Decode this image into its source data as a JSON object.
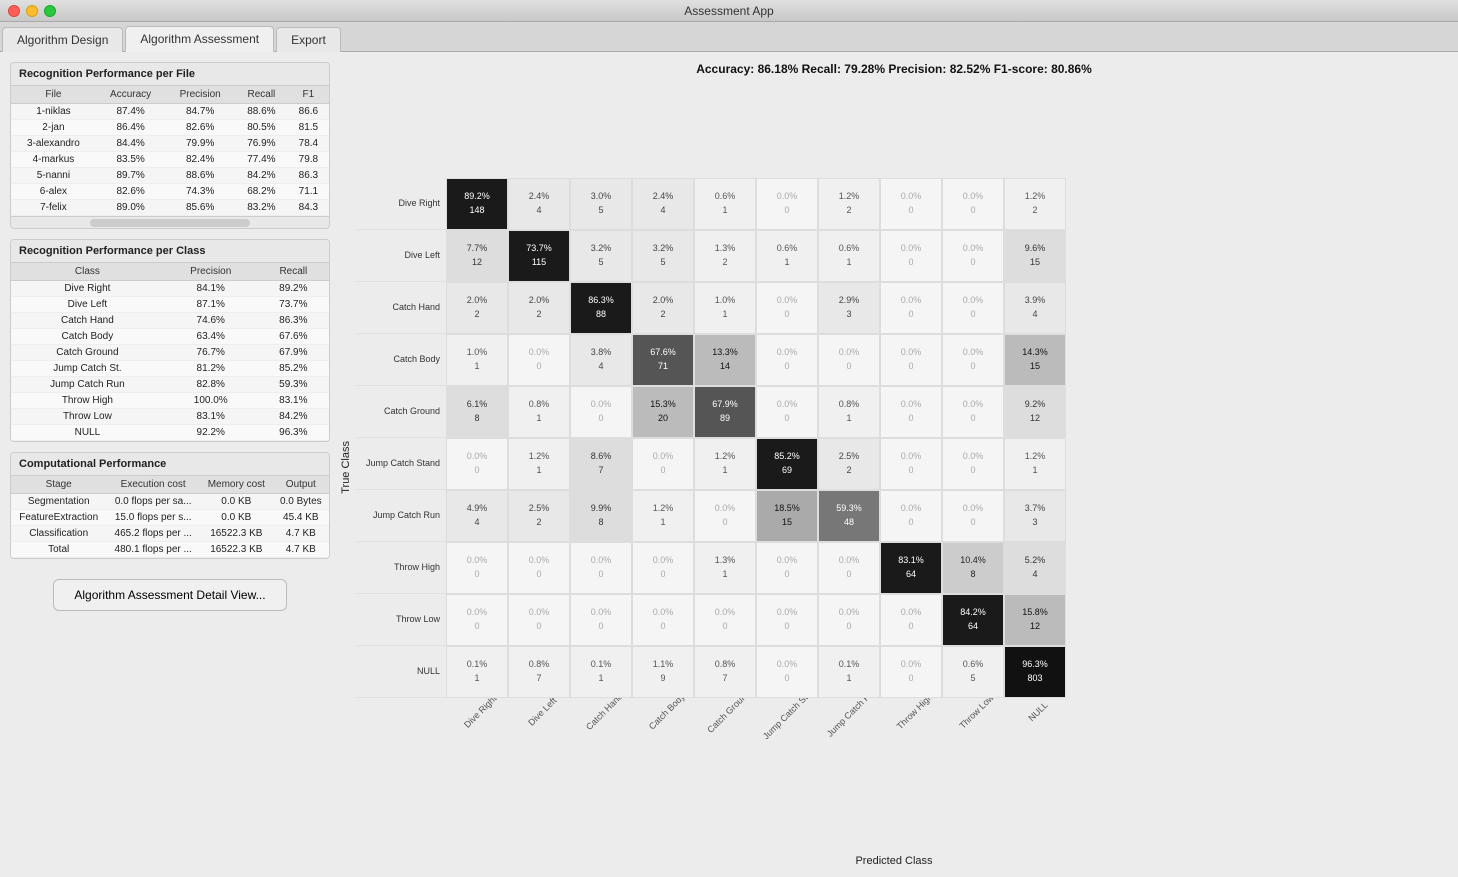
{
  "app": {
    "title": "Assessment App",
    "tabs": [
      {
        "id": "algorithm-design",
        "label": "Algorithm Design",
        "active": false
      },
      {
        "id": "algorithm-assessment",
        "label": "Algorithm Assessment",
        "active": true
      },
      {
        "id": "export",
        "label": "Export",
        "active": false
      }
    ]
  },
  "recognition_per_file": {
    "title": "Recognition Performance per File",
    "columns": [
      "File",
      "Accuracy",
      "Precision",
      "Recall",
      "F1"
    ],
    "rows": [
      {
        "file": "1-niklas",
        "accuracy": "87.4%",
        "precision": "84.7%",
        "recall": "88.6%",
        "f1": "86.6"
      },
      {
        "file": "2-jan",
        "accuracy": "86.4%",
        "precision": "82.6%",
        "recall": "80.5%",
        "f1": "81.5"
      },
      {
        "file": "3-alexandro",
        "accuracy": "84.4%",
        "precision": "79.9%",
        "recall": "76.9%",
        "f1": "78.4"
      },
      {
        "file": "4-markus",
        "accuracy": "83.5%",
        "precision": "82.4%",
        "recall": "77.4%",
        "f1": "79.8"
      },
      {
        "file": "5-nanni",
        "accuracy": "89.7%",
        "precision": "88.6%",
        "recall": "84.2%",
        "f1": "86.3"
      },
      {
        "file": "6-alex",
        "accuracy": "82.6%",
        "precision": "74.3%",
        "recall": "68.2%",
        "f1": "71.1"
      },
      {
        "file": "7-felix",
        "accuracy": "89.0%",
        "precision": "85.6%",
        "recall": "83.2%",
        "f1": "84.3"
      }
    ]
  },
  "recognition_per_class": {
    "title": "Recognition Performance per Class",
    "columns": [
      "Class",
      "Precision",
      "Recall"
    ],
    "rows": [
      {
        "class": "Dive Right",
        "precision": "84.1%",
        "recall": "89.2%"
      },
      {
        "class": "Dive Left",
        "precision": "87.1%",
        "recall": "73.7%"
      },
      {
        "class": "Catch Hand",
        "precision": "74.6%",
        "recall": "86.3%"
      },
      {
        "class": "Catch Body",
        "precision": "63.4%",
        "recall": "67.6%"
      },
      {
        "class": "Catch Ground",
        "precision": "76.7%",
        "recall": "67.9%"
      },
      {
        "class": "Jump Catch St.",
        "precision": "81.2%",
        "recall": "85.2%"
      },
      {
        "class": "Jump Catch Run",
        "precision": "82.8%",
        "recall": "59.3%"
      },
      {
        "class": "Throw High",
        "precision": "100.0%",
        "recall": "83.1%"
      },
      {
        "class": "Throw Low",
        "precision": "83.1%",
        "recall": "84.2%"
      },
      {
        "class": "NULL",
        "precision": "92.2%",
        "recall": "96.3%"
      }
    ]
  },
  "computational_performance": {
    "title": "Computational Performance",
    "columns": [
      "Stage",
      "Execution cost",
      "Memory cost",
      "Output"
    ],
    "rows": [
      {
        "stage": "Segmentation",
        "execution": "0.0 flops per sa...",
        "memory": "0.0 KB",
        "output": "0.0 Bytes"
      },
      {
        "stage": "FeatureExtraction",
        "execution": "15.0 flops per s...",
        "memory": "0.0 KB",
        "output": "45.4 KB"
      },
      {
        "stage": "Classification",
        "execution": "465.2 flops per ...",
        "memory": "16522.3 KB",
        "output": "4.7 KB"
      },
      {
        "stage": "Total",
        "execution": "480.1 flops per ...",
        "memory": "16522.3 KB",
        "output": "4.7 KB"
      }
    ]
  },
  "confusion_matrix": {
    "accuracy_line": "Accuracy: 86.18%  Recall: 79.28%  Precision: 82.52%  F1-score: 80.86%",
    "true_class_label": "True Class",
    "predicted_class_label": "Predicted Class",
    "row_labels": [
      "Dive Right",
      "Dive Left",
      "Catch Hand",
      "Catch Body",
      "Catch Ground",
      "Jump Catch Stand",
      "Jump Catch Run",
      "Throw High",
      "Throw Low",
      "NULL"
    ],
    "col_labels": [
      "Dive Right",
      "Dive Left",
      "Catch Hand",
      "Catch Body",
      "Catch Ground",
      "Jump Catch Stand",
      "Jump Catch Run",
      "Throw High",
      "Throw Low",
      "NULL"
    ],
    "cells": [
      [
        {
          "pct": "89.2%",
          "count": "148",
          "level": "high"
        },
        {
          "pct": "2.4%",
          "count": "4",
          "level": "zero"
        },
        {
          "pct": "3.0%",
          "count": "5",
          "level": "zero"
        },
        {
          "pct": "2.4%",
          "count": "4",
          "level": "zero"
        },
        {
          "pct": "0.6%",
          "count": "1",
          "level": "zero"
        },
        {
          "pct": "0.0%",
          "count": "0",
          "level": "zero"
        },
        {
          "pct": "1.2%",
          "count": "2",
          "level": "zero"
        },
        {
          "pct": "0.0%",
          "count": "0",
          "level": "zero"
        },
        {
          "pct": "0.0%",
          "count": "0",
          "level": "zero"
        },
        {
          "pct": "1.2%",
          "count": "2",
          "level": "zero"
        }
      ],
      [
        {
          "pct": "7.7%",
          "count": "12",
          "level": "zero"
        },
        {
          "pct": "73.7%",
          "count": "115",
          "level": "high"
        },
        {
          "pct": "3.2%",
          "count": "5",
          "level": "zero"
        },
        {
          "pct": "3.2%",
          "count": "5",
          "level": "zero"
        },
        {
          "pct": "1.3%",
          "count": "2",
          "level": "zero"
        },
        {
          "pct": "0.6%",
          "count": "1",
          "level": "zero"
        },
        {
          "pct": "0.6%",
          "count": "1",
          "level": "zero"
        },
        {
          "pct": "0.0%",
          "count": "0",
          "level": "zero"
        },
        {
          "pct": "0.0%",
          "count": "0",
          "level": "zero"
        },
        {
          "pct": "9.6%",
          "count": "15",
          "level": "zero"
        }
      ],
      [
        {
          "pct": "2.0%",
          "count": "2",
          "level": "zero"
        },
        {
          "pct": "2.0%",
          "count": "2",
          "level": "zero"
        },
        {
          "pct": "86.3%",
          "count": "88",
          "level": "high"
        },
        {
          "pct": "2.0%",
          "count": "2",
          "level": "zero"
        },
        {
          "pct": "1.0%",
          "count": "1",
          "level": "zero"
        },
        {
          "pct": "0.0%",
          "count": "0",
          "level": "zero"
        },
        {
          "pct": "2.9%",
          "count": "3",
          "level": "zero"
        },
        {
          "pct": "0.0%",
          "count": "0",
          "level": "zero"
        },
        {
          "pct": "0.0%",
          "count": "0",
          "level": "zero"
        },
        {
          "pct": "3.9%",
          "count": "4",
          "level": "zero"
        }
      ],
      [
        {
          "pct": "1.0%",
          "count": "1",
          "level": "zero"
        },
        {
          "pct": "0.0%",
          "count": "0",
          "level": "zero"
        },
        {
          "pct": "3.8%",
          "count": "4",
          "level": "zero"
        },
        {
          "pct": "67.6%",
          "count": "71",
          "level": "med-high"
        },
        {
          "pct": "13.3%",
          "count": "14",
          "level": "low"
        },
        {
          "pct": "0.0%",
          "count": "0",
          "level": "zero"
        },
        {
          "pct": "0.0%",
          "count": "0",
          "level": "zero"
        },
        {
          "pct": "0.0%",
          "count": "0",
          "level": "zero"
        },
        {
          "pct": "0.0%",
          "count": "0",
          "level": "zero"
        },
        {
          "pct": "14.3%",
          "count": "15",
          "level": "low"
        }
      ],
      [
        {
          "pct": "6.1%",
          "count": "8",
          "level": "zero"
        },
        {
          "pct": "0.8%",
          "count": "1",
          "level": "zero"
        },
        {
          "pct": "0.0%",
          "count": "0",
          "level": "zero"
        },
        {
          "pct": "15.3%",
          "count": "20",
          "level": "low"
        },
        {
          "pct": "67.9%",
          "count": "89",
          "level": "med-high"
        },
        {
          "pct": "0.0%",
          "count": "0",
          "level": "zero"
        },
        {
          "pct": "0.8%",
          "count": "1",
          "level": "zero"
        },
        {
          "pct": "0.0%",
          "count": "0",
          "level": "zero"
        },
        {
          "pct": "0.0%",
          "count": "0",
          "level": "zero"
        },
        {
          "pct": "9.2%",
          "count": "12",
          "level": "zero"
        }
      ],
      [
        {
          "pct": "0.0%",
          "count": "0",
          "level": "zero"
        },
        {
          "pct": "1.2%",
          "count": "1",
          "level": "zero"
        },
        {
          "pct": "8.6%",
          "count": "7",
          "level": "zero"
        },
        {
          "pct": "0.0%",
          "count": "0",
          "level": "zero"
        },
        {
          "pct": "1.2%",
          "count": "1",
          "level": "zero"
        },
        {
          "pct": "85.2%",
          "count": "69",
          "level": "high"
        },
        {
          "pct": "2.5%",
          "count": "2",
          "level": "zero"
        },
        {
          "pct": "0.0%",
          "count": "0",
          "level": "zero"
        },
        {
          "pct": "0.0%",
          "count": "0",
          "level": "zero"
        },
        {
          "pct": "1.2%",
          "count": "1",
          "level": "zero"
        }
      ],
      [
        {
          "pct": "4.9%",
          "count": "4",
          "level": "zero"
        },
        {
          "pct": "2.5%",
          "count": "2",
          "level": "zero"
        },
        {
          "pct": "9.9%",
          "count": "8",
          "level": "zero"
        },
        {
          "pct": "1.2%",
          "count": "1",
          "level": "zero"
        },
        {
          "pct": "0.0%",
          "count": "0",
          "level": "zero"
        },
        {
          "pct": "18.5%",
          "count": "15",
          "level": "low-med"
        },
        {
          "pct": "59.3%",
          "count": "48",
          "level": "med"
        },
        {
          "pct": "0.0%",
          "count": "0",
          "level": "zero"
        },
        {
          "pct": "0.0%",
          "count": "0",
          "level": "zero"
        },
        {
          "pct": "3.7%",
          "count": "3",
          "level": "zero"
        }
      ],
      [
        {
          "pct": "0.0%",
          "count": "0",
          "level": "zero"
        },
        {
          "pct": "0.0%",
          "count": "0",
          "level": "zero"
        },
        {
          "pct": "0.0%",
          "count": "0",
          "level": "zero"
        },
        {
          "pct": "0.0%",
          "count": "0",
          "level": "zero"
        },
        {
          "pct": "1.3%",
          "count": "1",
          "level": "zero"
        },
        {
          "pct": "0.0%",
          "count": "0",
          "level": "zero"
        },
        {
          "pct": "0.0%",
          "count": "0",
          "level": "zero"
        },
        {
          "pct": "83.1%",
          "count": "64",
          "level": "high"
        },
        {
          "pct": "10.4%",
          "count": "8",
          "level": "zero"
        },
        {
          "pct": "5.2%",
          "count": "4",
          "level": "zero"
        }
      ],
      [
        {
          "pct": "0.0%",
          "count": "0",
          "level": "zero"
        },
        {
          "pct": "0.0%",
          "count": "0",
          "level": "zero"
        },
        {
          "pct": "0.0%",
          "count": "0",
          "level": "zero"
        },
        {
          "pct": "0.0%",
          "count": "0",
          "level": "zero"
        },
        {
          "pct": "0.0%",
          "count": "0",
          "level": "zero"
        },
        {
          "pct": "0.0%",
          "count": "0",
          "level": "zero"
        },
        {
          "pct": "0.0%",
          "count": "0",
          "level": "zero"
        },
        {
          "pct": "0.0%",
          "count": "0",
          "level": "zero"
        },
        {
          "pct": "84.2%",
          "count": "64",
          "level": "high"
        },
        {
          "pct": "15.8%",
          "count": "12",
          "level": "low"
        }
      ],
      [
        {
          "pct": "0.1%",
          "count": "1",
          "level": "zero"
        },
        {
          "pct": "0.8%",
          "count": "7",
          "level": "zero"
        },
        {
          "pct": "0.1%",
          "count": "1",
          "level": "zero"
        },
        {
          "pct": "1.1%",
          "count": "9",
          "level": "zero"
        },
        {
          "pct": "0.8%",
          "count": "7",
          "level": "zero"
        },
        {
          "pct": "0.0%",
          "count": "0",
          "level": "zero"
        },
        {
          "pct": "0.1%",
          "count": "1",
          "level": "zero"
        },
        {
          "pct": "0.0%",
          "count": "0",
          "level": "zero"
        },
        {
          "pct": "0.6%",
          "count": "5",
          "level": "zero"
        },
        {
          "pct": "96.3%",
          "count": "803",
          "level": "very-high"
        }
      ]
    ]
  },
  "detail_button": {
    "label": "Algorithm Assessment Detail View..."
  }
}
